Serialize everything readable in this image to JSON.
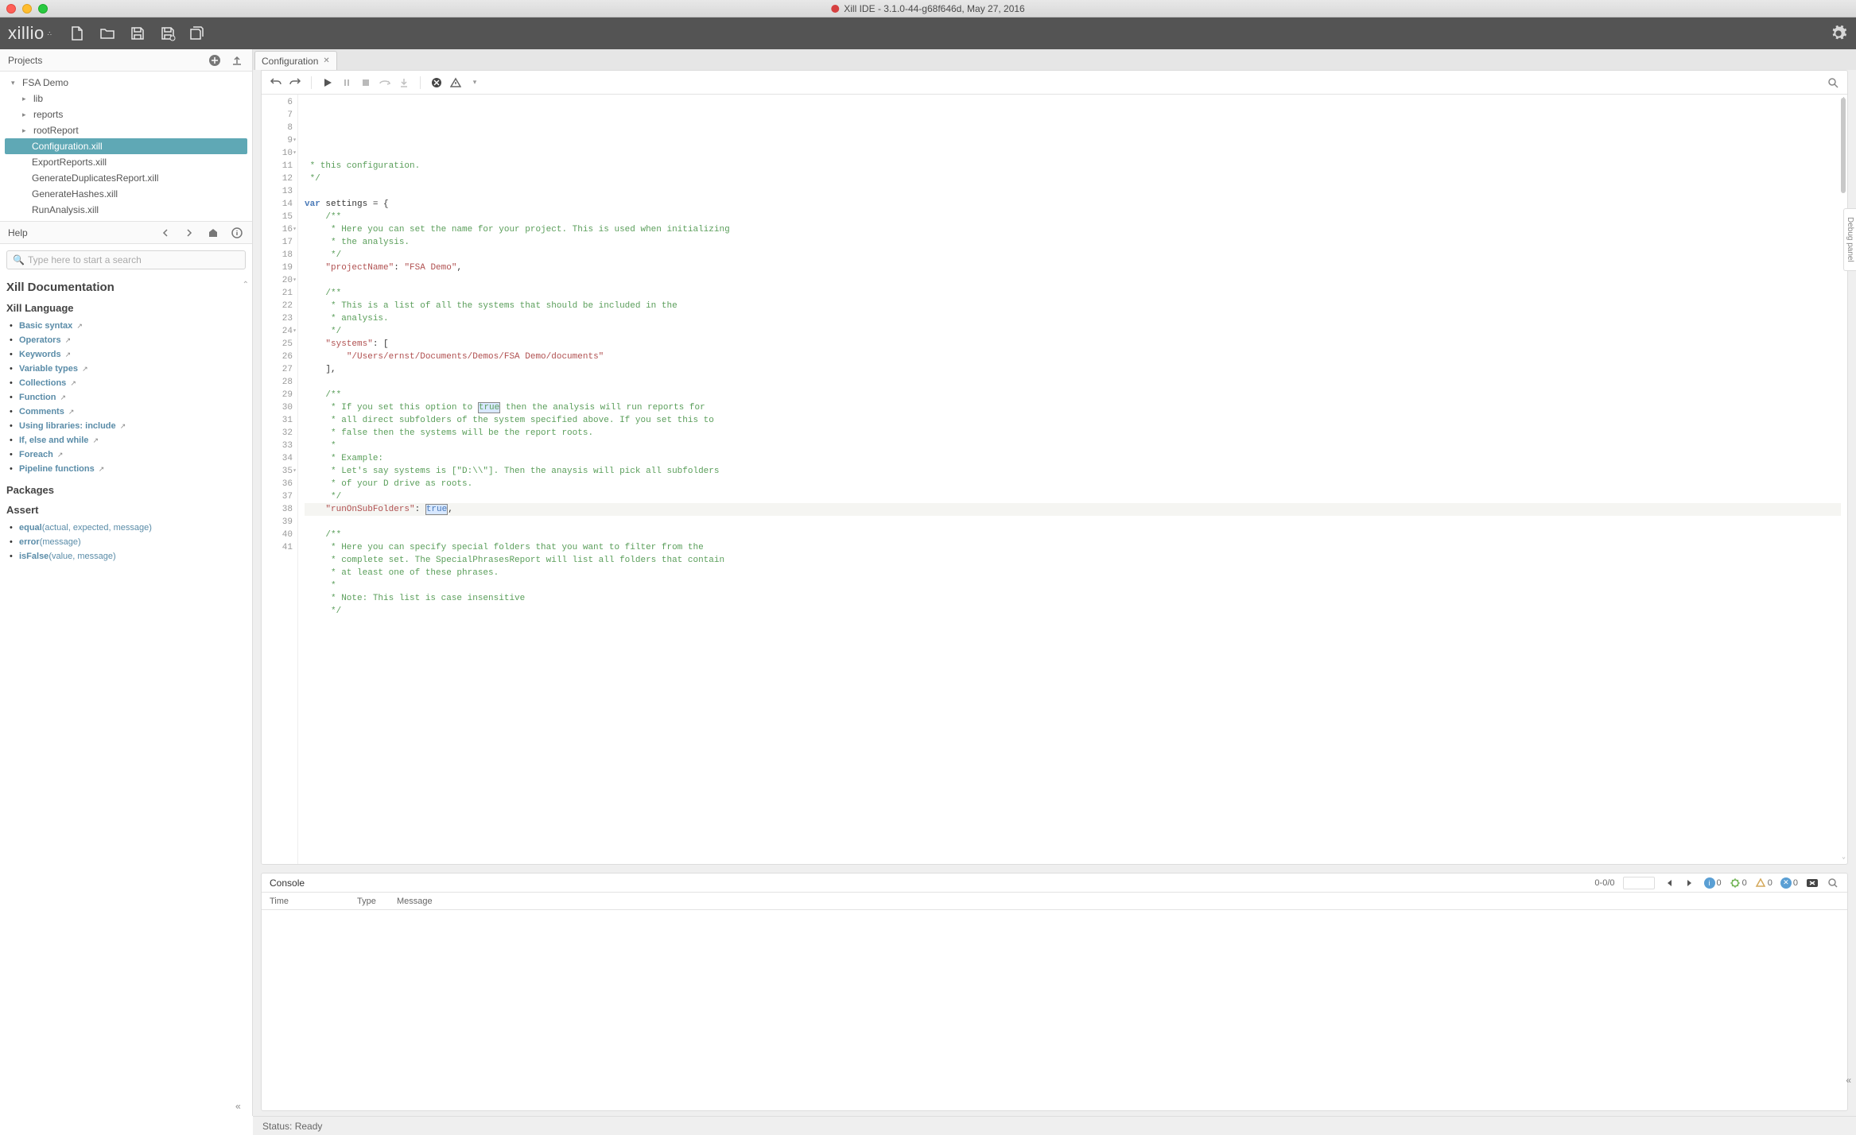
{
  "window": {
    "title": "Xill IDE - 3.1.0-44-g68f646d, May 27, 2016"
  },
  "logo": "xillio",
  "sidebar": {
    "projects_label": "Projects",
    "tree": {
      "root": "FSA Demo",
      "folders": [
        "lib",
        "reports",
        "rootReport"
      ],
      "files": [
        "Configuration.xill",
        "ExportReports.xill",
        "GenerateDuplicatesReport.xill",
        "GenerateHashes.xill",
        "RunAnalysis.xill"
      ],
      "selected": "Configuration.xill"
    },
    "help": {
      "label": "Help",
      "search_placeholder": "Type here to start a search",
      "doc_title": "Xill Documentation",
      "lang_title": "Xill Language",
      "lang_items": [
        "Basic syntax",
        "Operators",
        "Keywords",
        "Variable types",
        "Collections",
        "Function",
        "Comments",
        "Using libraries: include",
        "If, else and while",
        "Foreach",
        "Pipeline functions"
      ],
      "packages_title": "Packages",
      "assert_title": "Assert",
      "assert_items": [
        {
          "name": "equal",
          "params": "(actual, expected, message)"
        },
        {
          "name": "error",
          "params": "(message)"
        },
        {
          "name": "isFalse",
          "params": "(value, message)"
        }
      ]
    }
  },
  "editor": {
    "tab": "Configuration",
    "gutter_start": 6,
    "lines": [
      {
        "n": 6,
        "seg": [
          {
            "t": " * this configuration.",
            "c": "comment"
          }
        ]
      },
      {
        "n": 7,
        "seg": [
          {
            "t": " */",
            "c": "comment"
          }
        ]
      },
      {
        "n": 8,
        "seg": []
      },
      {
        "n": 9,
        "fold": true,
        "seg": [
          {
            "t": "var ",
            "c": "keyword"
          },
          {
            "t": "settings = {",
            "c": ""
          }
        ]
      },
      {
        "n": 10,
        "fold": true,
        "seg": [
          {
            "t": "    /**",
            "c": "comment"
          }
        ]
      },
      {
        "n": 11,
        "seg": [
          {
            "t": "     * Here you can set the name for your project. This is used when initializing",
            "c": "comment"
          }
        ]
      },
      {
        "n": 12,
        "seg": [
          {
            "t": "     * the analysis.",
            "c": "comment"
          }
        ]
      },
      {
        "n": 13,
        "seg": [
          {
            "t": "     */",
            "c": "comment"
          }
        ]
      },
      {
        "n": 14,
        "seg": [
          {
            "t": "    ",
            "c": ""
          },
          {
            "t": "\"projectName\"",
            "c": "key"
          },
          {
            "t": ": ",
            "c": ""
          },
          {
            "t": "\"FSA Demo\"",
            "c": "string"
          },
          {
            "t": ",",
            "c": ""
          }
        ]
      },
      {
        "n": 15,
        "seg": []
      },
      {
        "n": 16,
        "fold": true,
        "seg": [
          {
            "t": "    /**",
            "c": "comment"
          }
        ]
      },
      {
        "n": 17,
        "seg": [
          {
            "t": "     * This is a list of all the systems that should be included in the",
            "c": "comment"
          }
        ]
      },
      {
        "n": 18,
        "seg": [
          {
            "t": "     * analysis.",
            "c": "comment"
          }
        ]
      },
      {
        "n": 19,
        "seg": [
          {
            "t": "     */",
            "c": "comment"
          }
        ]
      },
      {
        "n": 20,
        "fold": true,
        "seg": [
          {
            "t": "    ",
            "c": ""
          },
          {
            "t": "\"systems\"",
            "c": "key"
          },
          {
            "t": ": [",
            "c": ""
          }
        ]
      },
      {
        "n": 21,
        "seg": [
          {
            "t": "        ",
            "c": ""
          },
          {
            "t": "\"/Users/ernst/Documents/Demos/FSA Demo/documents\"",
            "c": "string"
          }
        ]
      },
      {
        "n": 22,
        "seg": [
          {
            "t": "    ],",
            "c": ""
          }
        ]
      },
      {
        "n": 23,
        "seg": []
      },
      {
        "n": 24,
        "fold": true,
        "seg": [
          {
            "t": "    /**",
            "c": "comment"
          }
        ]
      },
      {
        "n": 25,
        "seg": [
          {
            "t": "     * If you set this option to ",
            "c": "comment"
          },
          {
            "t": "true",
            "c": "comment hl"
          },
          {
            "t": " then the analysis will run reports for",
            "c": "comment"
          }
        ]
      },
      {
        "n": 26,
        "seg": [
          {
            "t": "     * all direct subfolders of the system specified above. If you set this to",
            "c": "comment"
          }
        ]
      },
      {
        "n": 27,
        "seg": [
          {
            "t": "     * false then the systems will be the report roots.",
            "c": "comment"
          }
        ]
      },
      {
        "n": 28,
        "seg": [
          {
            "t": "     *",
            "c": "comment"
          }
        ]
      },
      {
        "n": 29,
        "seg": [
          {
            "t": "     * Example:",
            "c": "comment"
          }
        ]
      },
      {
        "n": 30,
        "seg": [
          {
            "t": "     * Let's say systems is [\"D:\\\\\"]. Then the anaysis will pick all subfolders",
            "c": "comment"
          }
        ]
      },
      {
        "n": 31,
        "seg": [
          {
            "t": "     * of your D drive as roots.",
            "c": "comment"
          }
        ]
      },
      {
        "n": 32,
        "seg": [
          {
            "t": "     */",
            "c": "comment"
          }
        ]
      },
      {
        "n": 33,
        "highlight": true,
        "seg": [
          {
            "t": "    ",
            "c": ""
          },
          {
            "t": "\"runOnSubFolders\"",
            "c": "key"
          },
          {
            "t": ": ",
            "c": ""
          },
          {
            "t": "true",
            "c": "val hl"
          },
          {
            "t": ",",
            "c": ""
          }
        ]
      },
      {
        "n": 34,
        "seg": []
      },
      {
        "n": 35,
        "fold": true,
        "seg": [
          {
            "t": "    /**",
            "c": "comment"
          }
        ]
      },
      {
        "n": 36,
        "seg": [
          {
            "t": "     * Here you can specify special folders that you want to filter from the",
            "c": "comment"
          }
        ]
      },
      {
        "n": 37,
        "seg": [
          {
            "t": "     * complete set. The SpecialPhrasesReport will list all folders that contain",
            "c": "comment"
          }
        ]
      },
      {
        "n": 38,
        "seg": [
          {
            "t": "     * at least one of these phrases.",
            "c": "comment"
          }
        ]
      },
      {
        "n": 39,
        "seg": [
          {
            "t": "     *",
            "c": "comment"
          }
        ]
      },
      {
        "n": 40,
        "seg": [
          {
            "t": "     * Note: This list is case insensitive",
            "c": "comment"
          }
        ]
      },
      {
        "n": 41,
        "seg": [
          {
            "t": "     */",
            "c": "comment"
          }
        ]
      }
    ]
  },
  "console": {
    "label": "Console",
    "count": "0-0/0",
    "badges": {
      "info": "0",
      "debug": "0",
      "warn": "0",
      "error": "0"
    },
    "cols": {
      "time": "Time",
      "type": "Type",
      "message": "Message"
    }
  },
  "debug_panel_label": "Debug panel",
  "status": {
    "text": "Status: Ready"
  }
}
